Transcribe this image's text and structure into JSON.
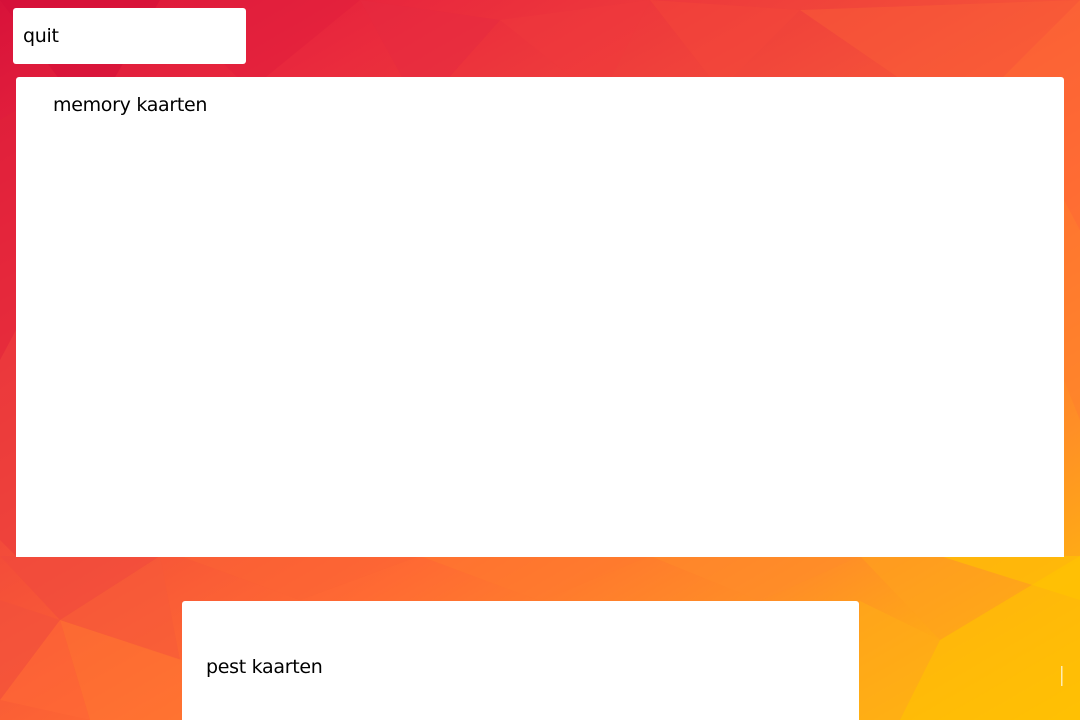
{
  "buttons": {
    "quit_label": "quit"
  },
  "menu": {
    "items": [
      {
        "label": "memory kaarten"
      },
      {
        "label": "pest kaarten"
      }
    ]
  },
  "colors": {
    "background_top_left": "#d8123a",
    "background_mid": "#ff6a33",
    "background_bottom_right": "#ffc400",
    "card": "#ffffff",
    "text": "#000000"
  }
}
